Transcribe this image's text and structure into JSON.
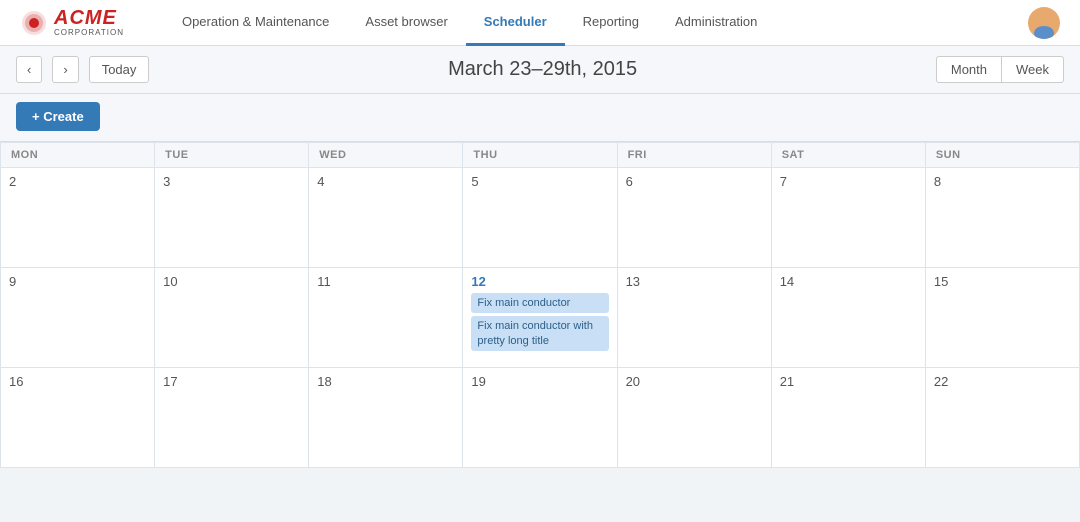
{
  "header": {
    "logo": {
      "acme": "ACME",
      "corporation": "CORPORATION"
    },
    "nav": [
      {
        "id": "operation",
        "label": "Operation & Maintenance",
        "active": false
      },
      {
        "id": "asset-browser",
        "label": "Asset browser",
        "active": false
      },
      {
        "id": "scheduler",
        "label": "Scheduler",
        "active": true
      },
      {
        "id": "reporting",
        "label": "Reporting",
        "active": false
      },
      {
        "id": "administration",
        "label": "Administration",
        "active": false
      }
    ]
  },
  "toolbar": {
    "prev_label": "‹",
    "next_label": "›",
    "today_label": "Today",
    "date_title": "March 23–29th, 2015",
    "month_label": "Month",
    "week_label": "Week"
  },
  "create_bar": {
    "create_label": "+ Create"
  },
  "calendar": {
    "day_headers": [
      "MON",
      "TUE",
      "WED",
      "THU",
      "FRI",
      "SAT",
      "SUN"
    ],
    "weeks": [
      [
        {
          "date": "2",
          "highlight": false,
          "events": []
        },
        {
          "date": "3",
          "highlight": false,
          "events": []
        },
        {
          "date": "4",
          "highlight": false,
          "events": []
        },
        {
          "date": "5",
          "highlight": false,
          "events": []
        },
        {
          "date": "6",
          "highlight": false,
          "events": []
        },
        {
          "date": "7",
          "highlight": false,
          "events": []
        },
        {
          "date": "8",
          "highlight": false,
          "events": []
        }
      ],
      [
        {
          "date": "9",
          "highlight": false,
          "events": []
        },
        {
          "date": "10",
          "highlight": false,
          "events": []
        },
        {
          "date": "11",
          "highlight": false,
          "events": []
        },
        {
          "date": "12",
          "highlight": true,
          "events": [
            "Fix main conductor",
            "Fix main conductor with pretty long title"
          ]
        },
        {
          "date": "13",
          "highlight": false,
          "events": []
        },
        {
          "date": "14",
          "highlight": false,
          "events": []
        },
        {
          "date": "15",
          "highlight": false,
          "events": []
        }
      ],
      [
        {
          "date": "16",
          "highlight": false,
          "events": []
        },
        {
          "date": "17",
          "highlight": false,
          "events": []
        },
        {
          "date": "18",
          "highlight": false,
          "events": []
        },
        {
          "date": "19",
          "highlight": false,
          "events": []
        },
        {
          "date": "20",
          "highlight": false,
          "events": []
        },
        {
          "date": "21",
          "highlight": false,
          "events": []
        },
        {
          "date": "22",
          "highlight": false,
          "events": []
        }
      ]
    ]
  }
}
